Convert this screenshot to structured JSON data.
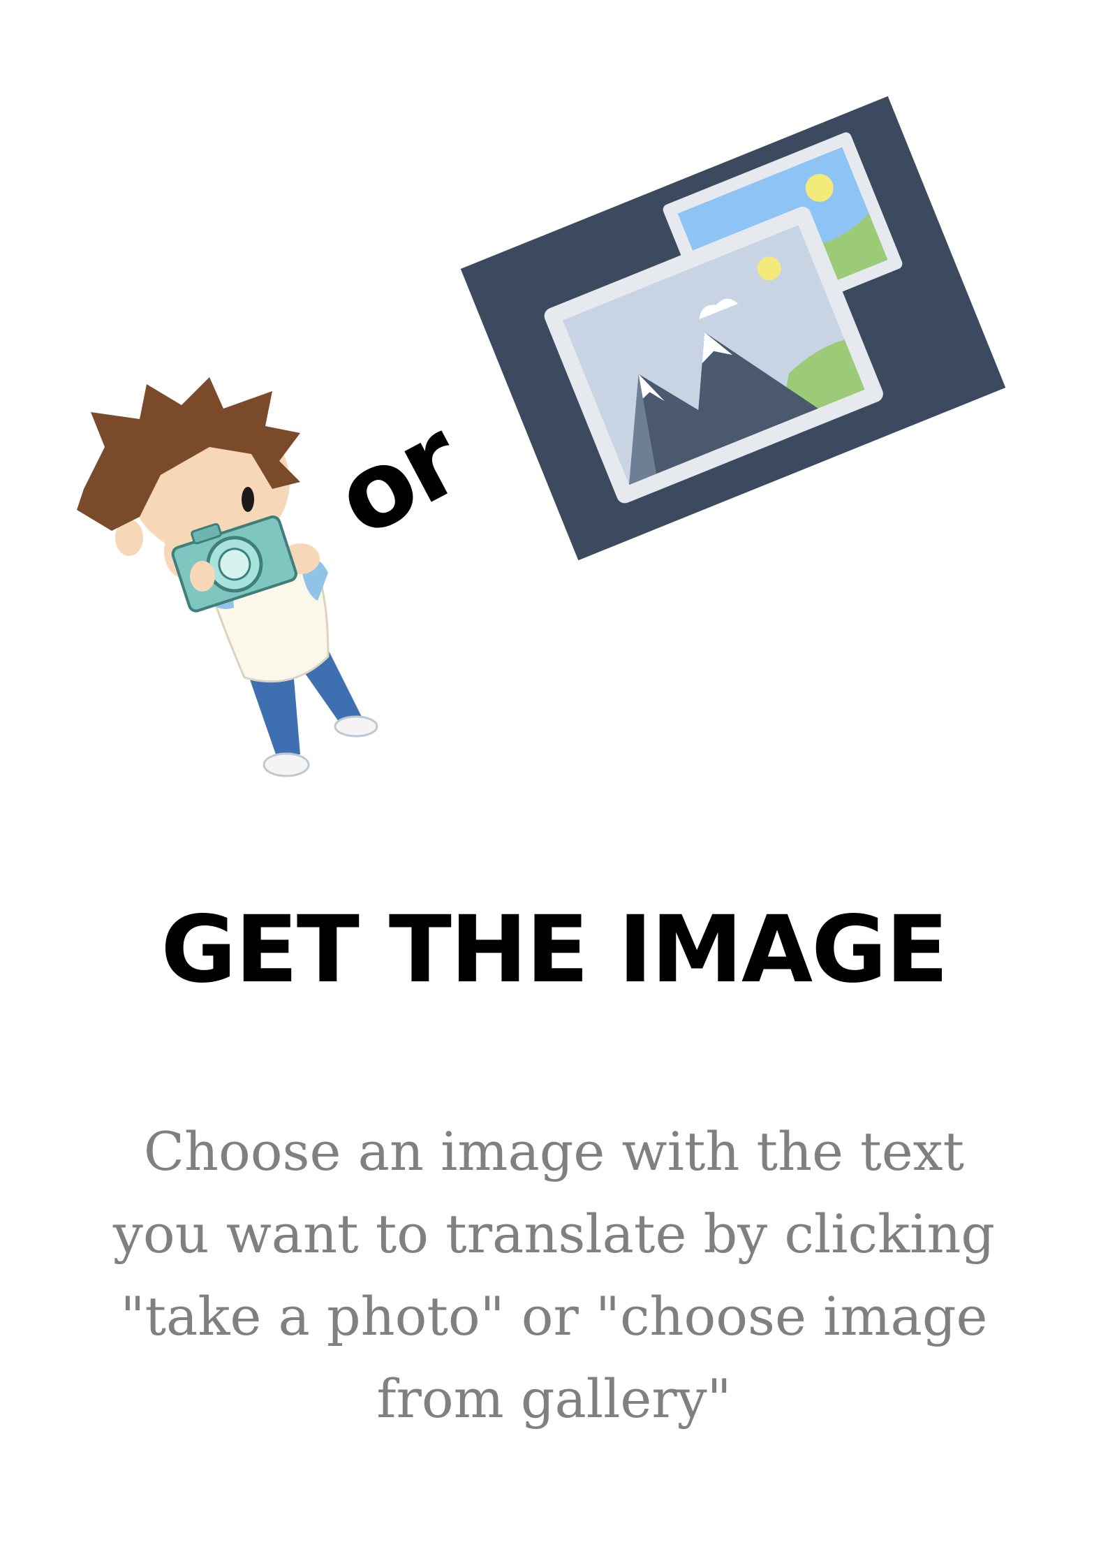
{
  "hero": {
    "separator_text": "or"
  },
  "title": "GET THE IMAGE",
  "description": {
    "lines": [
      "Choose an image with the text",
      "you want to translate by clicking",
      "\"take a photo\" or \"choose image",
      "from gallery\""
    ]
  },
  "colors": {
    "title": "#000000",
    "description": "#808080",
    "gallery_background": "#3b4a5f",
    "photo_frame": "#e6e9ee",
    "sky_light": "#c8d4e3",
    "sky_blue": "#8ec3f5",
    "sun": "#f3ea7a",
    "hill_green": "#9ccb78",
    "mountain_dark": "#4a596d",
    "camera_teal": "#7fc6c0",
    "hair_brown": "#7a4a2a",
    "skin": "#f6d7b8",
    "jeans_blue": "#3e6fb0"
  },
  "icons": {
    "boy_with_camera": "boy-camera-illustration",
    "gallery": "gallery-photos-icon"
  }
}
